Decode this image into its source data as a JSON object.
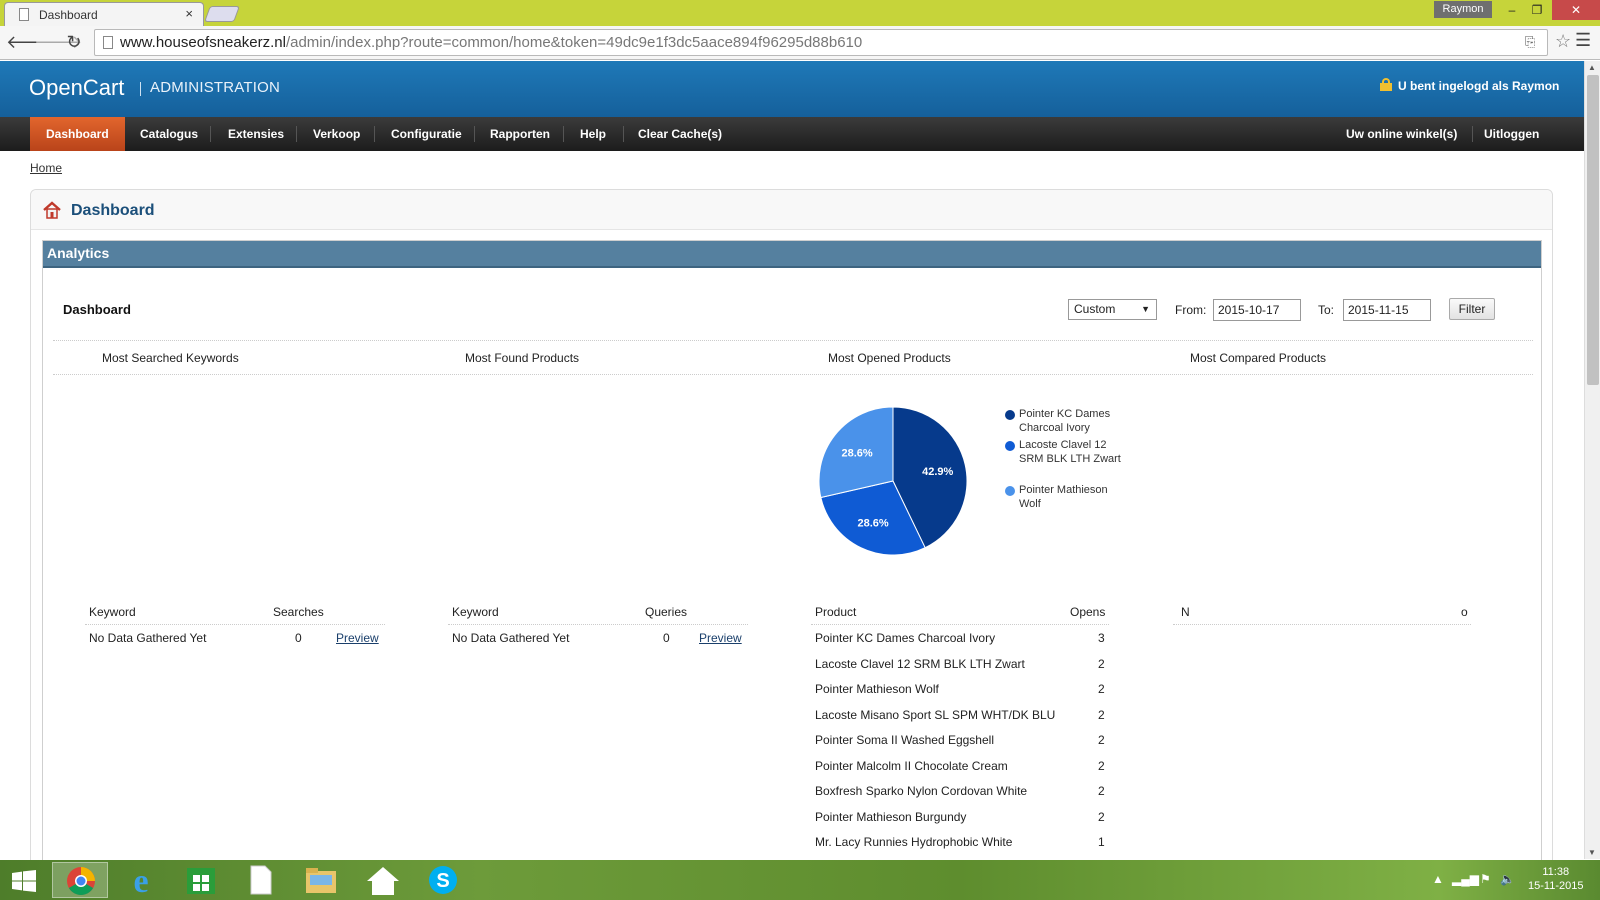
{
  "browser": {
    "tab_title": "Dashboard",
    "tab_close": "×",
    "user_badge": "Raymon",
    "window_min": "–",
    "window_max": "❐",
    "window_close": "✕",
    "url_host": "www.houseofsneakerz.nl",
    "url_path": "/admin/index.php?route=common/home&token=49dc9e1f3dc5aace894f96295d88b610"
  },
  "header": {
    "logo": "OpenCart",
    "section": "ADMINISTRATION",
    "logged_in_text": "U bent ingelogd als Raymon"
  },
  "menu": {
    "items": [
      "Dashboard",
      "Catalogus",
      "Extensies",
      "Verkoop",
      "Configuratie",
      "Rapporten",
      "Help",
      "Clear Cache(s)"
    ],
    "right_items": [
      "Uw online winkel(s)",
      "Uitloggen"
    ]
  },
  "breadcrumb": "Home",
  "page_title": "Dashboard",
  "analytics": {
    "heading": "Analytics",
    "inner_title": "Dashboard",
    "range_select": "Custom",
    "from_label": "From:",
    "from_value": "2015-10-17",
    "to_label": "To:",
    "to_value": "2015-11-15",
    "filter_button": "Filter",
    "columns": [
      "Most Searched Keywords",
      "Most Found Products",
      "Most Opened Products",
      "Most Compared Products"
    ]
  },
  "chart_data": {
    "type": "pie",
    "title": "",
    "categories": [
      "Pointer KC Dames Charcoal Ivory",
      "Lacoste Clavel 12 SRM BLK LTH Zwart",
      "Pointer Mathieson Wolf"
    ],
    "values": [
      42.9,
      28.6,
      28.6
    ],
    "labels": [
      "42.9%",
      "28.6%",
      "28.6%"
    ],
    "colors": [
      "#063a8c",
      "#0f5bd4",
      "#4a92ea"
    ],
    "legend": "right"
  },
  "searched_table": {
    "headers": [
      "Keyword",
      "Searches"
    ],
    "rows": [
      [
        "No Data Gathered Yet",
        "0",
        "Preview"
      ]
    ]
  },
  "found_table": {
    "headers": [
      "Keyword",
      "Queries"
    ],
    "rows": [
      [
        "No Data Gathered Yet",
        "0",
        "Preview"
      ]
    ]
  },
  "opened_table": {
    "headers": [
      "Product",
      "Opens"
    ],
    "rows": [
      [
        "Pointer KC Dames Charcoal Ivory",
        "3"
      ],
      [
        "Lacoste Clavel 12 SRM BLK LTH Zwart",
        "2"
      ],
      [
        "Pointer Mathieson Wolf",
        "2"
      ],
      [
        "Lacoste Misano Sport SL SPM WHT/DK BLU",
        "2"
      ],
      [
        "Pointer Soma II Washed Eggshell",
        "2"
      ],
      [
        "Pointer Malcolm II Chocolate Cream",
        "2"
      ],
      [
        "Boxfresh Sparko Nylon Cordovan White",
        "2"
      ],
      [
        "Pointer Mathieson Burgundy",
        "2"
      ],
      [
        "Mr. Lacy Runnies Hydrophobic White",
        "1"
      ]
    ]
  },
  "compared_table": {
    "headers": [
      "N",
      "o"
    ]
  },
  "taskbar": {
    "clock_time": "11:38",
    "clock_date": "15-11-2015"
  }
}
